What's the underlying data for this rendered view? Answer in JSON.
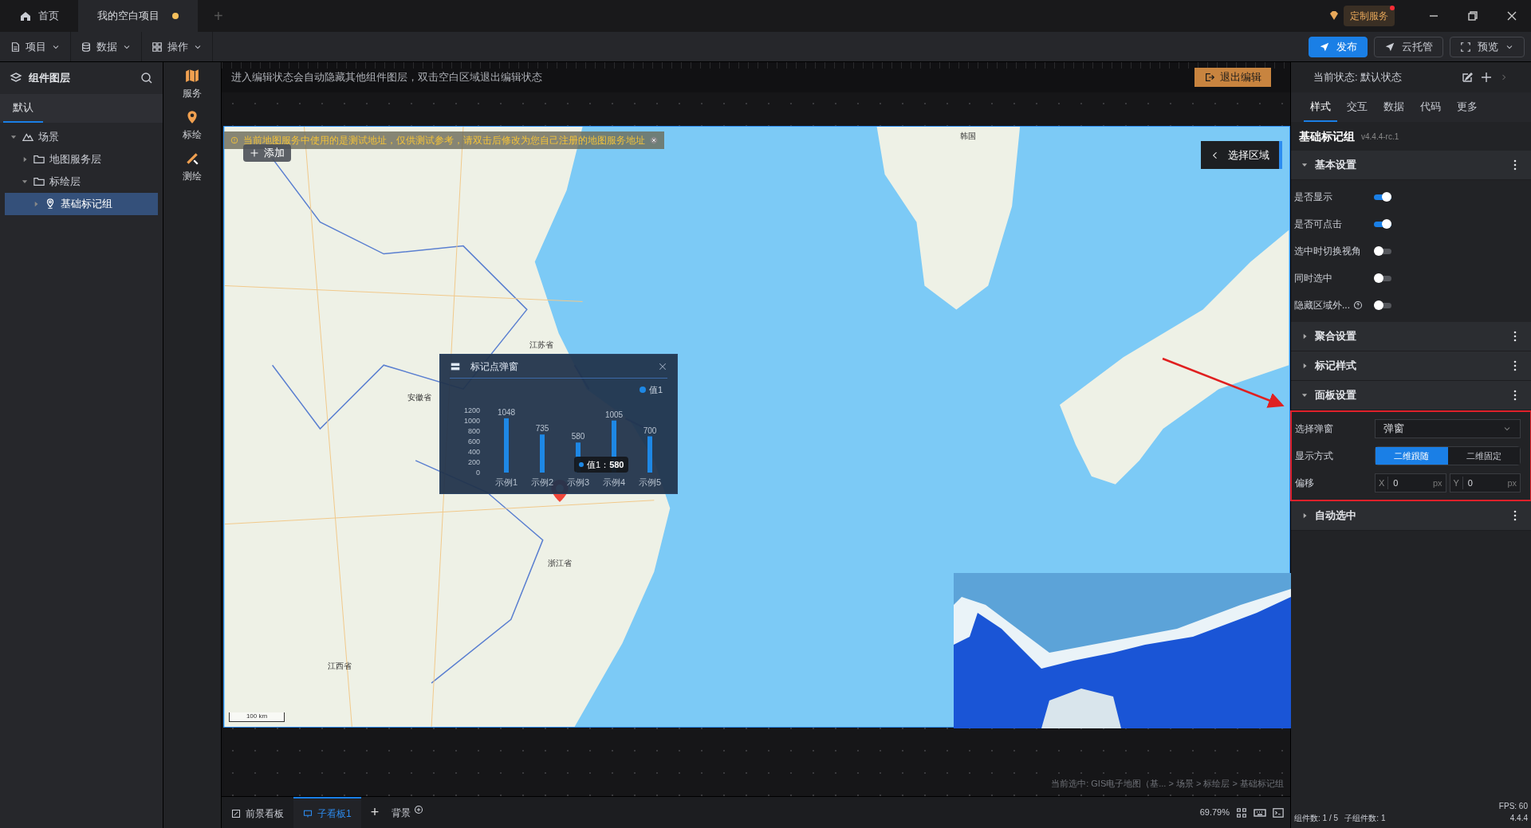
{
  "title_bar": {
    "tabs": [
      {
        "label": "首页",
        "kind": "home",
        "selected": false,
        "modified": false
      },
      {
        "label": "我的空白项目",
        "kind": "doc",
        "selected": true,
        "modified": true
      }
    ],
    "new_tab": "+",
    "service": {
      "label": "定制服务",
      "notify": true
    }
  },
  "toolbar": {
    "menus": [
      {
        "label": "项目",
        "kind": "file"
      },
      {
        "label": "数据",
        "kind": "database"
      },
      {
        "label": "操作",
        "kind": "grid"
      }
    ],
    "actions": [
      {
        "label": "发布",
        "kind": "primary"
      },
      {
        "label": "云托管",
        "kind": "plain"
      },
      {
        "label": "预览",
        "kind": "dropdown"
      }
    ]
  },
  "layers_panel": {
    "title": "组件图层",
    "tabs": [
      {
        "label": "默认",
        "selected": true
      }
    ],
    "tree": [
      {
        "label": "场景",
        "kind": "scene",
        "expanded": true,
        "selected": false,
        "children": [
          {
            "label": "地图服务层",
            "kind": "folder",
            "expanded": false,
            "selected": false
          },
          {
            "label": "标绘层",
            "kind": "folder",
            "expanded": true,
            "selected": false,
            "children": [
              {
                "label": "基础标记组",
                "kind": "marker",
                "expanded": false,
                "selected": true
              }
            ]
          }
        ]
      }
    ]
  },
  "tool_strip": [
    {
      "label": "服务",
      "kind": "map"
    },
    {
      "label": "标绘",
      "kind": "pin"
    },
    {
      "label": "测绘",
      "kind": "ruler"
    }
  ],
  "canvas": {
    "edit_hint": "进入编辑状态会自动隐藏其他组件图层，双击空白区域退出编辑状态",
    "exit_button": "退出编辑",
    "map": {
      "warning": "当前地图服务中使用的是测试地址，仅供测试参考，请双击后修改为您自己注册的地图服务地址",
      "add_button": "添加",
      "region_button": "选择区域",
      "labels": [
        "韩国",
        "江苏省",
        "安徽省",
        "浙江省",
        "江西省"
      ],
      "scale": "100 km",
      "popup": {
        "title": "标记点弹窗",
        "tooltip": "值1：**580**",
        "chart_data": {
          "type": "bar",
          "categories": [
            "示例1",
            "示例2",
            "示例3",
            "示例4",
            "示例5"
          ],
          "series": [
            {
              "name": "值1",
              "color": "#1e88e5",
              "values": [
                1048,
                735,
                580,
                1005,
                700
              ]
            }
          ],
          "ylim": [
            0,
            1200
          ],
          "yticks": [
            0,
            200,
            400,
            600,
            800,
            1000,
            1200
          ],
          "data_labels": true
        }
      }
    },
    "selection_path": "当前选中: GIS电子地图（基... > 场景 > 标绘层 > 基础标记组"
  },
  "bottom_bar": {
    "tabs": [
      {
        "label": "前景看板",
        "kind": "board",
        "selected": false
      },
      {
        "label": "子看板1",
        "kind": "sub",
        "selected": true
      }
    ],
    "add": "+",
    "background": "背景",
    "zoom": "69.79%"
  },
  "properties_panel": {
    "state_label": "当前状态: 默认状态",
    "tabs": [
      {
        "label": "样式",
        "selected": true
      },
      {
        "label": "交互",
        "selected": false
      },
      {
        "label": "数据",
        "selected": false
      },
      {
        "label": "代码",
        "selected": false
      },
      {
        "label": "更多",
        "selected": false
      }
    ],
    "component": "基础标记组",
    "version": "v4.4.4-rc.1",
    "sections": [
      {
        "title": "基本设置",
        "expanded": true,
        "rows": [
          {
            "kind": "toggle",
            "label": "是否显示",
            "on": true
          },
          {
            "kind": "toggle",
            "label": "是否可点击",
            "on": true
          },
          {
            "kind": "toggle",
            "label": "选中时切换视角",
            "on": false
          },
          {
            "kind": "toggle",
            "label": "同时选中",
            "on": false
          },
          {
            "kind": "toggle",
            "label": "隐藏区域外...",
            "on": false,
            "help": true
          }
        ]
      },
      {
        "title": "聚合设置",
        "expanded": false
      },
      {
        "title": "标记样式",
        "expanded": false
      },
      {
        "title": "面板设置",
        "expanded": true,
        "highlighted": true,
        "rows": [
          {
            "kind": "select",
            "label": "选择弹窗",
            "value": "弹窗"
          },
          {
            "kind": "segmented",
            "label": "显示方式",
            "options": [
              {
                "label": "二维跟随",
                "selected": true
              },
              {
                "label": "二维固定",
                "selected": false
              }
            ]
          },
          {
            "kind": "offset",
            "label": "偏移",
            "fields": [
              {
                "axis": "X",
                "value": "0",
                "unit": "px"
              },
              {
                "axis": "Y",
                "value": "0",
                "unit": "px"
              }
            ]
          }
        ]
      },
      {
        "title": "自动选中",
        "expanded": false
      }
    ]
  },
  "status": {
    "fps": "FPS: 60",
    "counts": "组件数: 1 / 5   子组件数: 1",
    "version": "4.4.4"
  }
}
